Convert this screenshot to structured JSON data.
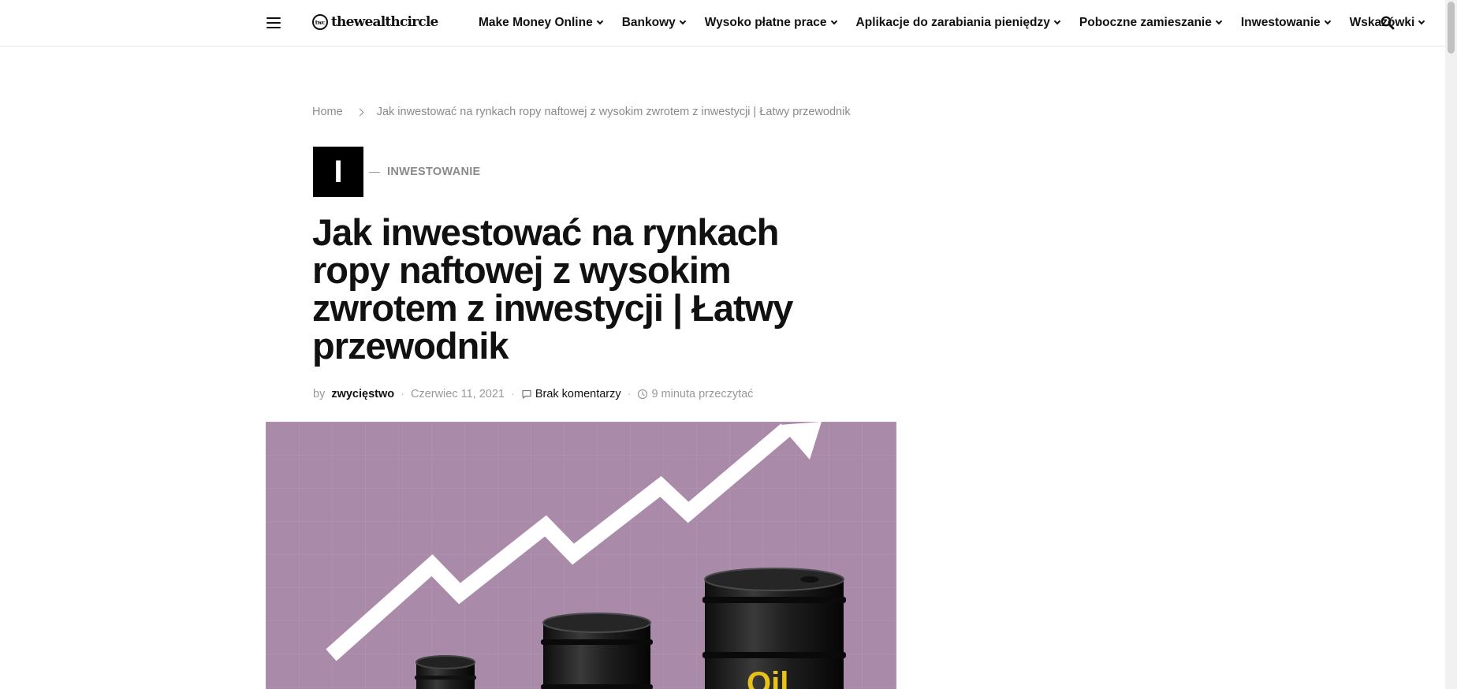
{
  "header": {
    "logo_mark": "twc",
    "logo_text": "thewealthcircle",
    "nav": [
      {
        "label": "Make Money Online"
      },
      {
        "label": "Bankowy"
      },
      {
        "label": "Wysoko płatne prace"
      },
      {
        "label": "Aplikacje do zarabiania pieniędzy"
      },
      {
        "label": "Poboczne zamieszanie"
      },
      {
        "label": "Inwestowanie"
      },
      {
        "label": "Wskazówki"
      }
    ]
  },
  "breadcrumb": {
    "home": "Home",
    "current": "Jak inwestować na rynkach ropy naftowej z wysokim zwrotem z inwestycji | Łatwy przewodnik"
  },
  "category": {
    "initial": "I",
    "label": "INWESTOWANIE"
  },
  "article": {
    "title": "Jak inwestować na rynkach ropy naftowej z wysokim zwrotem z inwestycji | Łatwy przewodnik",
    "by": "by",
    "author": "zwycięstwo",
    "date": "Czerwiec 11, 2021",
    "comments": "Brak komentarzy",
    "read_time": "9 minuta przeczytać"
  },
  "hero": {
    "barrel_label": "Oil"
  },
  "colors": {
    "hero_bg": "#a98aa9",
    "accent": "#111111"
  }
}
